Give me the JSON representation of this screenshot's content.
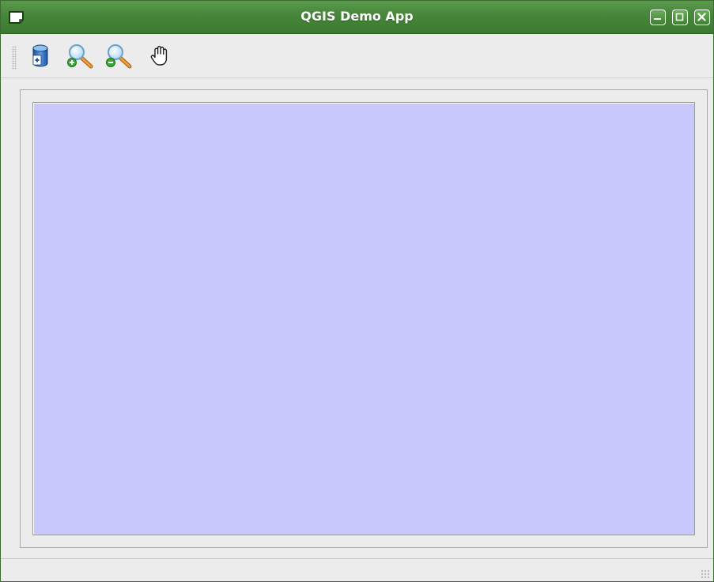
{
  "window": {
    "title": "QGIS Demo App"
  },
  "titlebar": {
    "controls": [
      "minimize",
      "maximize",
      "close"
    ]
  },
  "toolbar": {
    "tools": [
      {
        "name": "add-layer",
        "icon": "database-add-icon"
      },
      {
        "name": "zoom-in",
        "icon": "zoom-in-icon"
      },
      {
        "name": "zoom-out",
        "icon": "zoom-out-icon"
      },
      {
        "name": "pan",
        "icon": "pan-hand-icon"
      }
    ]
  },
  "map_canvas": {
    "background_color": "#c8c8fd"
  },
  "colors": {
    "titlebar": "#47863a",
    "window_bg": "#ececec",
    "canvas_bg": "#c8c8fd"
  },
  "statusbar": {
    "text": ""
  }
}
